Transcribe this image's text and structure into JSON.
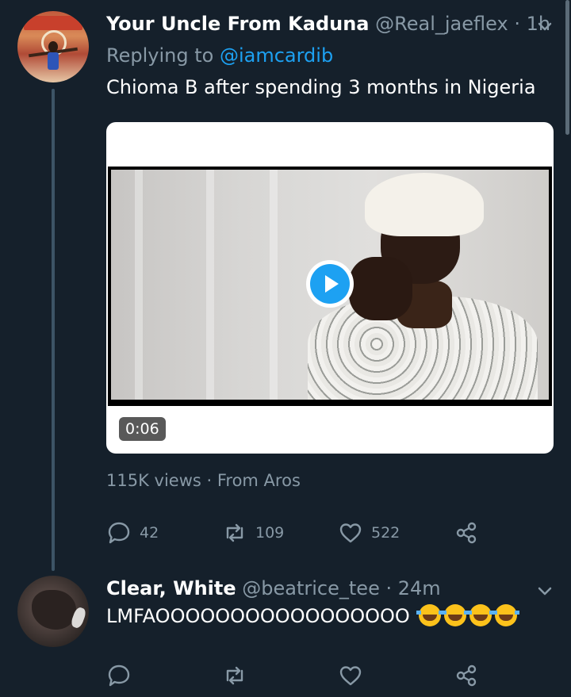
{
  "tweet1": {
    "display_name": "Your Uncle From Kaduna",
    "handle": "@Real_jaeflex",
    "separator": "·",
    "time": "1h",
    "replying_prefix": "Replying to",
    "replying_mention": "@iamcardib",
    "text": "Chioma B after spending 3 months in Nigeria",
    "video_duration": "0:06",
    "views_text": "115K views · From Aros",
    "reply_count": "42",
    "retweet_count": "109",
    "like_count": "522"
  },
  "tweet2": {
    "display_name": "Clear, White",
    "handle": "@beatrice_tee",
    "separator": "·",
    "time": "24m",
    "text": "LMFAOOOOOOOOOOOOOOOOO"
  },
  "colors": {
    "background": "#15202b",
    "secondary_text": "#8899a6",
    "accent": "#1da1f2",
    "thread_line": "#3d5466"
  },
  "icons": [
    "chevron-down-icon",
    "play-icon",
    "reply-icon",
    "retweet-icon",
    "like-icon",
    "share-icon",
    "laughing-emoji-icon"
  ]
}
